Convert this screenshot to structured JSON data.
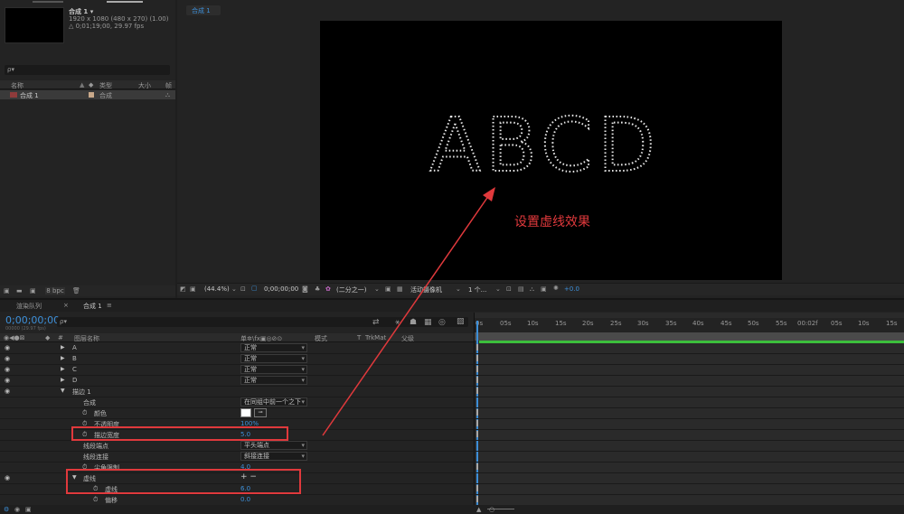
{
  "project": {
    "comp_name": "合成 1 ▾",
    "comp_info1": "1920 x 1080  (480 x 270) (1.00)",
    "comp_info2": "△ 0;01;19;00, 29.97 fps",
    "search_placeholder": "ρ▾",
    "columns": [
      "名称",
      "类型",
      "大小",
      "帧"
    ],
    "item": {
      "name": "合成 1",
      "type": "合成"
    },
    "bpc": "8 bpc"
  },
  "viewer": {
    "tab": "合成 1",
    "letters": "ABCD",
    "annotation": "设置虚线效果",
    "zoom": "(44.4%)",
    "timecode": "0;00;00;00",
    "resolution": "(二分之一)",
    "camera": "活动摄像机",
    "views": "1 个...",
    "exposure": "+0.0"
  },
  "timeline": {
    "tabs": [
      "渲染队列",
      "合成 1"
    ],
    "current_time": "0;00;00;00",
    "fps_info": "00000 (29.97 fps)",
    "search_placeholder": "ρ▾",
    "headers": {
      "num": "#",
      "name": "图层名称",
      "switches": "单✲\\fx▣◎⊘⊙",
      "mode": "模式",
      "t": "T",
      "trkmat": "TrkMat",
      "parent": "父级"
    },
    "ruler_labels": [
      "0s",
      "05s",
      "10s",
      "15s",
      "20s",
      "25s",
      "30s",
      "35s",
      "40s",
      "45s",
      "50s",
      "55s",
      "00:02f",
      "05s",
      "10s",
      "15s"
    ],
    "layers": [
      {
        "name": "A",
        "mode": "正常"
      },
      {
        "name": "B",
        "mode": "正常"
      },
      {
        "name": "C",
        "mode": "正常"
      },
      {
        "name": "D",
        "mode": "正常"
      },
      {
        "name": "描边 1"
      }
    ],
    "props": {
      "composite_label": "合成",
      "composite_value": "在同组中前一个之下",
      "color_label": "颜色",
      "opacity_label": "不透明度",
      "opacity_value": "100%",
      "stroke_width_label": "描边宽度",
      "stroke_width_value": "5.0",
      "line_cap_label": "线段端点",
      "line_cap_value": "平头端点",
      "line_join_label": "线段连接",
      "line_join_value": "斜接连接",
      "miter_label": "尖角限制",
      "miter_value": "4.0",
      "dash_group_label": "虚线",
      "dash_controls": "+ −",
      "dash_label": "虚线",
      "dash_value": "6.0",
      "offset_label": "偏移",
      "offset_value": "0.0"
    }
  },
  "colors": {
    "accent": "#3d8fd8",
    "annotation": "#e0393c",
    "worktrack": "#3cbf3c"
  }
}
